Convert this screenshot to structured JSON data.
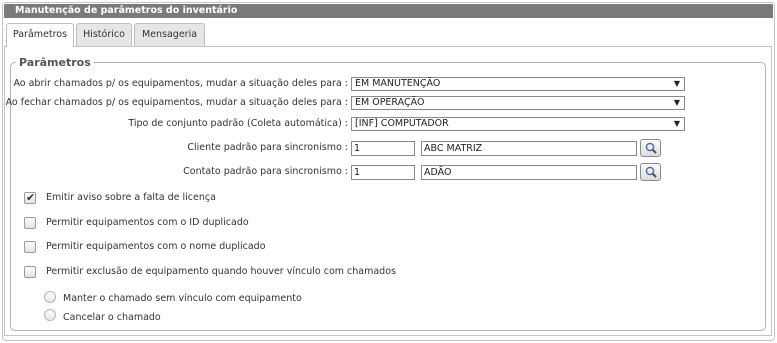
{
  "window": {
    "title": "Manutenção de parâmetros do inventário"
  },
  "tabs": [
    {
      "label": "Parâmetros",
      "active": true
    },
    {
      "label": "Histórico",
      "active": false
    },
    {
      "label": "Mensageria",
      "active": false
    }
  ],
  "fieldset": {
    "legend": "Parâmetros"
  },
  "fields": {
    "abrir": {
      "label": "Ao abrir chamados p/ os equipamentos, mudar a situação deles para :",
      "value": "EM MANUTENÇÃO"
    },
    "fechar": {
      "label": "Ao fechar chamados p/ os equipamentos, mudar a situação deles para :",
      "value": "EM OPERAÇÃO"
    },
    "tipo": {
      "label": "Tipo de conjunto padrão (Coleta automática) :",
      "value": "[INF] COMPUTADOR"
    },
    "cliente": {
      "label": "Cliente padrão para sincronismo :",
      "code": "1",
      "name": "ABC MATRIZ"
    },
    "contato": {
      "label": "Contato padrão para sincronismo :",
      "code": "1",
      "name": "ADÃO"
    }
  },
  "checkboxes": [
    {
      "label": "Emitir aviso sobre a falta de licença",
      "checked": true
    },
    {
      "label": "Permitir equipamentos com o ID duplicado",
      "checked": false
    },
    {
      "label": "Permitir equipamentos com o nome duplicado",
      "checked": false
    },
    {
      "label": "Permitir exclusão de equipamento quando houver vínculo com chamados",
      "checked": false
    }
  ],
  "radios": [
    {
      "label": "Manter o chamado sem vínculo com equipamento",
      "selected": false
    },
    {
      "label": "Cancelar o chamado",
      "selected": false
    }
  ],
  "icons": {
    "dropdown": "chevron-down-icon",
    "search": "magnifier-icon",
    "check": "checkmark-icon"
  },
  "colors": {
    "titlebar": "#7a7a7a",
    "border": "#c5c5c5",
    "tab_inactive": "#e6e6e6"
  }
}
